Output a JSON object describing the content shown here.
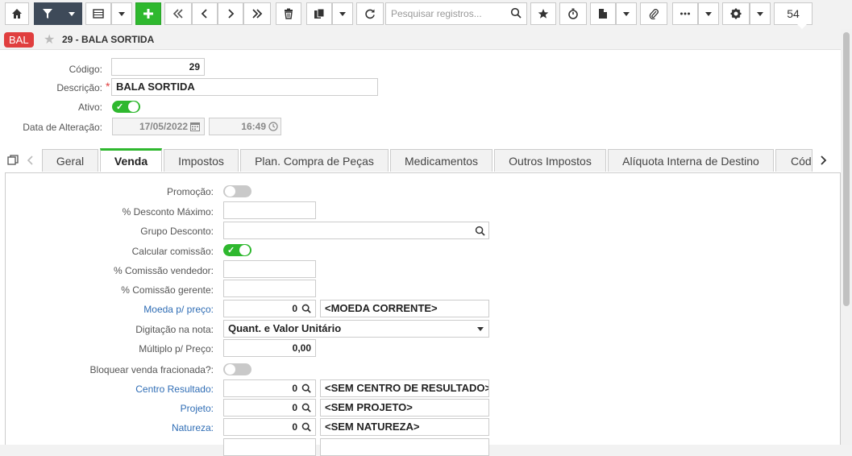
{
  "toolbar": {
    "search_placeholder": "Pesquisar registros...",
    "record_count": "54"
  },
  "record": {
    "badge": "BAL",
    "title": "29 - BALA SORTIDA"
  },
  "header_form": {
    "codigo_label": "Código:",
    "codigo_value": "29",
    "descricao_label": "Descrição:",
    "descricao_required": "*",
    "descricao_value": "BALA SORTIDA",
    "ativo_label": "Ativo:",
    "ativo_on": true,
    "data_alteracao_label": "Data de Alteração:",
    "data_value": "17/05/2022",
    "hora_value": "16:49"
  },
  "tabs": [
    {
      "label": "Geral"
    },
    {
      "label": "Venda",
      "active": true
    },
    {
      "label": "Impostos"
    },
    {
      "label": "Plan. Compra de Peças"
    },
    {
      "label": "Medicamentos"
    },
    {
      "label": "Outros Impostos"
    },
    {
      "label": "Alíquota Interna de Destino"
    },
    {
      "label": "Cód"
    }
  ],
  "venda": {
    "promocao_label": "Promoção:",
    "promocao_on": false,
    "desconto_maximo_label": "% Desconto Máximo:",
    "desconto_maximo_value": "",
    "grupo_desconto_label": "Grupo Desconto:",
    "grupo_desconto_value": "",
    "calcular_comissao_label": "Calcular comissão:",
    "calcular_comissao_on": true,
    "comissao_vendedor_label": "% Comissão vendedor:",
    "comissao_vendedor_value": "",
    "comissao_gerente_label": "% Comissão gerente:",
    "comissao_gerente_value": "",
    "moeda_label": "Moeda p/ preço:",
    "moeda_code": "0",
    "moeda_desc": "<MOEDA CORRENTE>",
    "digitacao_label": "Digitação na nota:",
    "digitacao_value": "Quant. e Valor Unitário",
    "multiplo_label": "Múltiplo p/ Preço:",
    "multiplo_value": "0,00",
    "bloquear_label": "Bloquear venda fracionada?:",
    "bloquear_on": false,
    "centro_label": "Centro Resultado:",
    "centro_code": "0",
    "centro_desc": "<SEM CENTRO DE RESULTADO>",
    "projeto_label": "Projeto:",
    "projeto_code": "0",
    "projeto_desc": "<SEM PROJETO>",
    "natureza_label": "Natureza:",
    "natureza_code": "0",
    "natureza_desc": "<SEM NATUREZA>"
  },
  "colors": {
    "accent_green": "#2eb82e",
    "dark_button": "#3e4a59",
    "badge_red": "#e03e3e",
    "link_blue": "#2f6db5"
  }
}
